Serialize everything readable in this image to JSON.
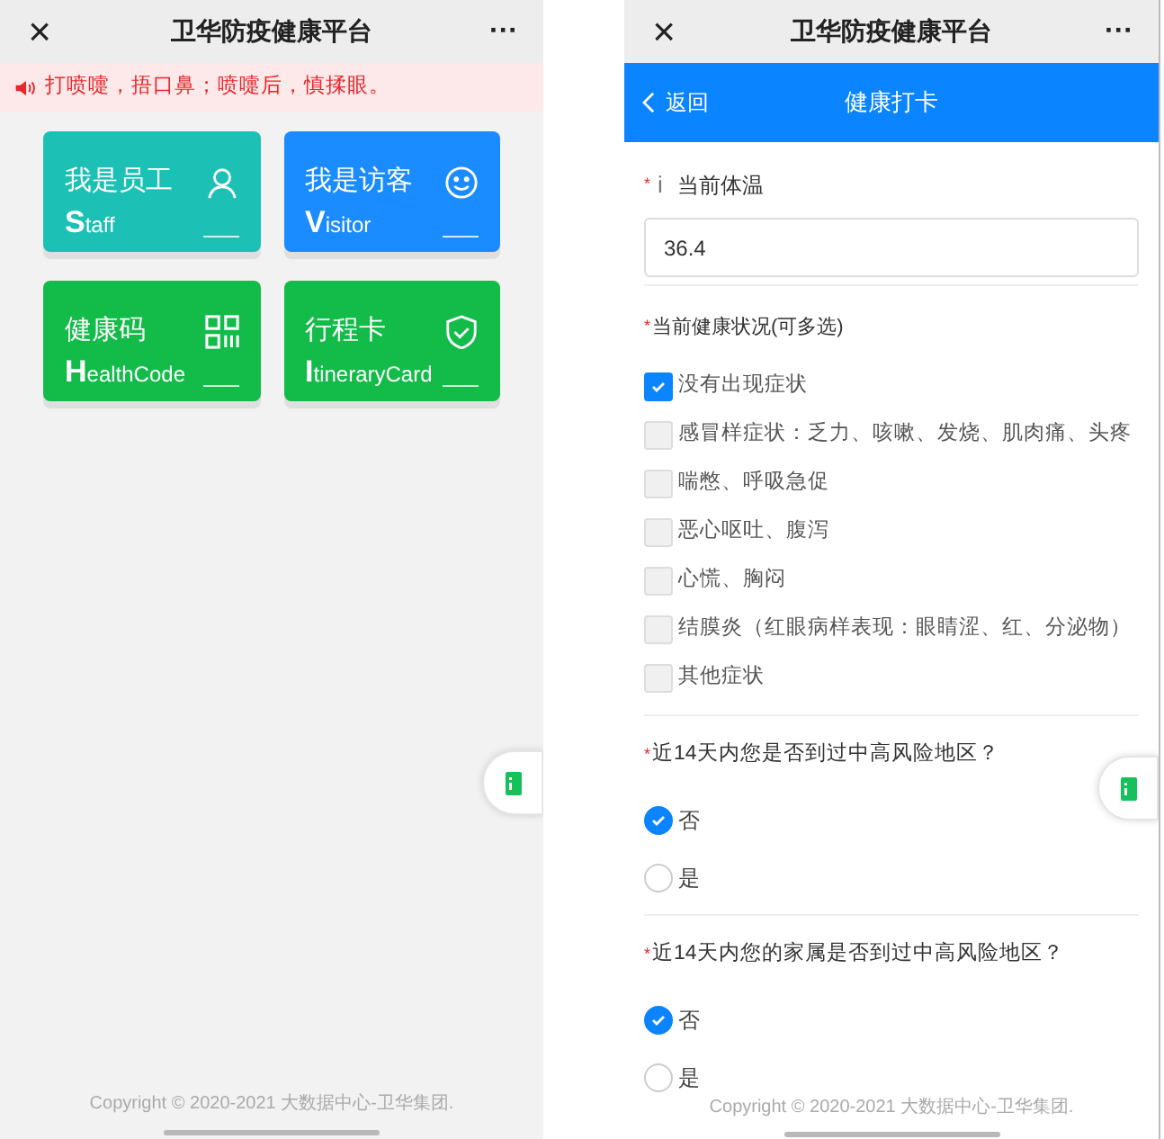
{
  "home_screen": {
    "title_bar": {
      "close": "×",
      "title": "卫华防疫健康平台",
      "more": "···"
    },
    "notice": "打喷嚏，捂口鼻；喷嚏后，慎揉眼。",
    "tiles": [
      {
        "title": "我是员工",
        "subtitle": "Staff",
        "color": "#1cc0b4"
      },
      {
        "title": "我是访客",
        "subtitle": "Visitor",
        "color": "#1a8cff"
      },
      {
        "title": "健康码",
        "subtitle": "HealthCode",
        "color": "#13bb49"
      },
      {
        "title": "行程卡",
        "subtitle": "ItineraryCard",
        "color": "#13bb49"
      }
    ],
    "copyright": "Copyright © 2020-2021 大数据中心-卫华集团."
  },
  "checkin_screen": {
    "title_bar": {
      "close": "×",
      "title": "卫华防疫健康平台",
      "more": "···"
    },
    "header": {
      "back": "返回",
      "title": "健康打卡"
    },
    "temperature": {
      "required_mark": "*",
      "info": "i",
      "label": "当前体温",
      "value": "36.4"
    },
    "symptoms": {
      "required_mark": "*",
      "label": "当前健康状况(可多选)",
      "options": [
        {
          "label": "没有出现症状",
          "checked": true
        },
        {
          "label": "感冒样症状：乏力、咳嗽、发烧、肌肉痛、头疼",
          "checked": false
        },
        {
          "label": "喘憋、呼吸急促",
          "checked": false
        },
        {
          "label": "恶心呕吐、腹泻",
          "checked": false
        },
        {
          "label": "心慌、胸闷",
          "checked": false
        },
        {
          "label": "结膜炎（红眼病样表现：眼睛涩、红、分泌物）",
          "checked": false
        },
        {
          "label": "其他症状",
          "checked": false
        }
      ]
    },
    "questions": [
      {
        "required_mark": "*",
        "label": "近14天内您是否到过中高风险地区？",
        "options": [
          {
            "label": "否",
            "selected": true
          },
          {
            "label": "是",
            "selected": false
          }
        ]
      },
      {
        "required_mark": "*",
        "label": "近14天内您的家属是否到过中高风险地区？",
        "options": [
          {
            "label": "否",
            "selected": true
          },
          {
            "label": "是",
            "selected": false
          }
        ]
      }
    ],
    "copyright": "Copyright © 2020-2021 大数据中心-卫华集团."
  }
}
